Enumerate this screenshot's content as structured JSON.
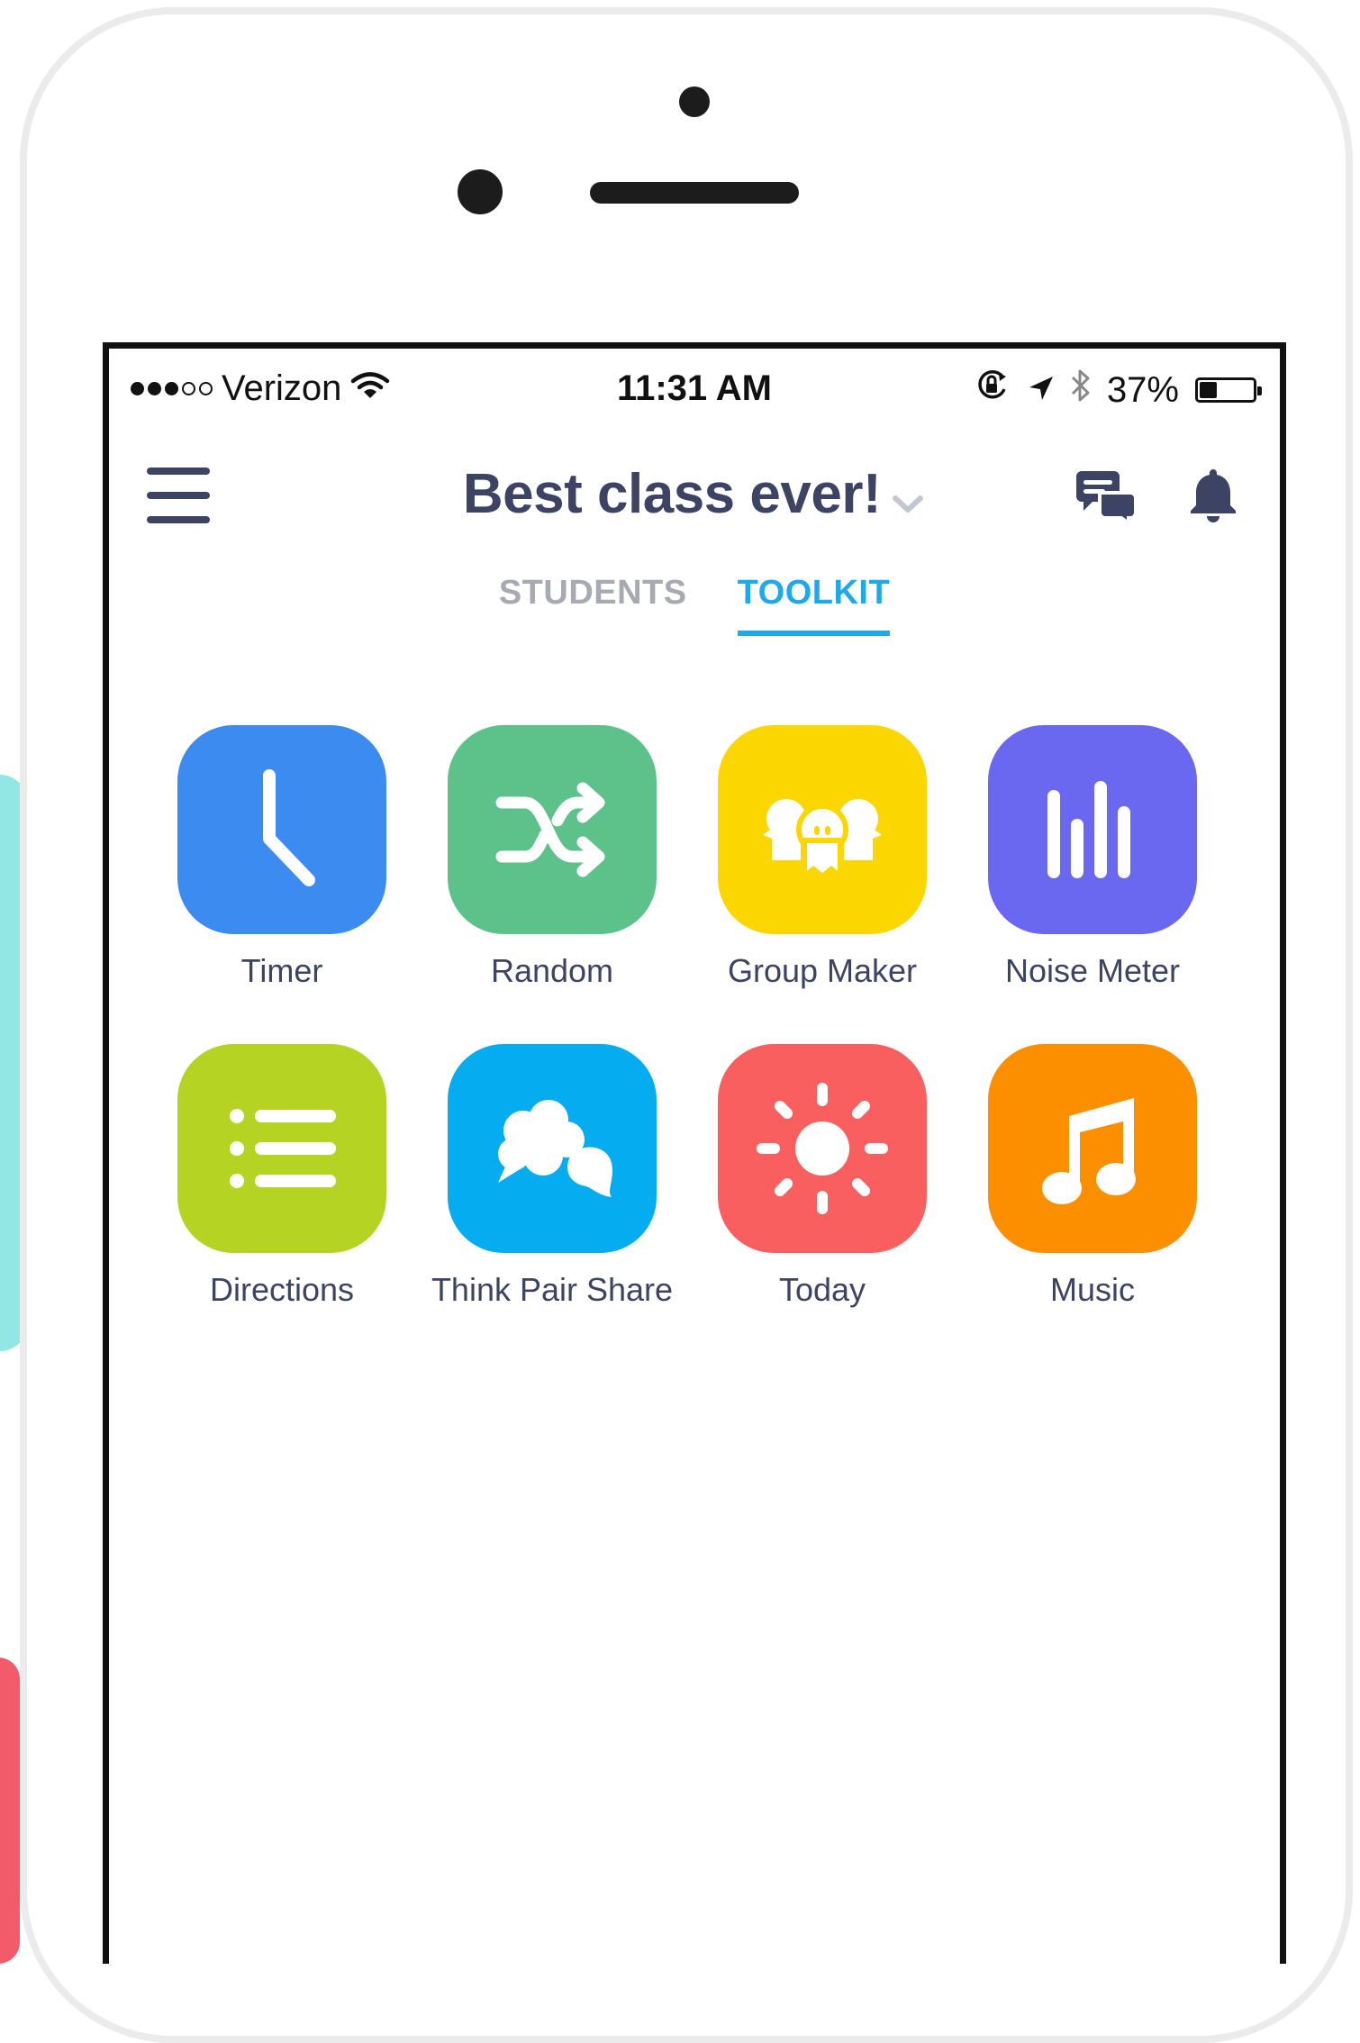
{
  "status_bar": {
    "carrier": "Verizon",
    "time": "11:31 AM",
    "battery": "37%",
    "battery_level": 0.37,
    "icons": [
      "signal-dots-icon",
      "wifi-icon",
      "orientation-lock-icon",
      "location-arrow-icon",
      "bluetooth-icon",
      "battery-icon"
    ]
  },
  "header": {
    "title": "Best class ever!",
    "icons": [
      "menu-icon",
      "chevron-down-icon",
      "messages-icon",
      "bell-icon"
    ]
  },
  "tabs": [
    {
      "label": "STUDENTS",
      "active": false
    },
    {
      "label": "TOOLKIT",
      "active": true
    }
  ],
  "tools": [
    {
      "label": "Timer",
      "icon": "clock-icon",
      "color": "#3b8bf1"
    },
    {
      "label": "Random",
      "icon": "shuffle-icon",
      "color": "#5cc28a"
    },
    {
      "label": "Group Maker",
      "icon": "group-icon",
      "color": "#fcd600"
    },
    {
      "label": "Noise Meter",
      "icon": "noise-bars-icon",
      "color": "#6a67f0"
    },
    {
      "label": "Directions",
      "icon": "list-icon",
      "color": "#b5d323"
    },
    {
      "label": "Think Pair Share",
      "icon": "speech-bubbles-icon",
      "color": "#05adf0"
    },
    {
      "label": "Today",
      "icon": "sun-icon",
      "color": "#f85f5e"
    },
    {
      "label": "Music",
      "icon": "music-note-icon",
      "color": "#fc8f00"
    }
  ],
  "colors": {
    "navy_text": "#3d4463",
    "accent_blue": "#1da9ec",
    "inactive_tab": "#a8aab2"
  }
}
